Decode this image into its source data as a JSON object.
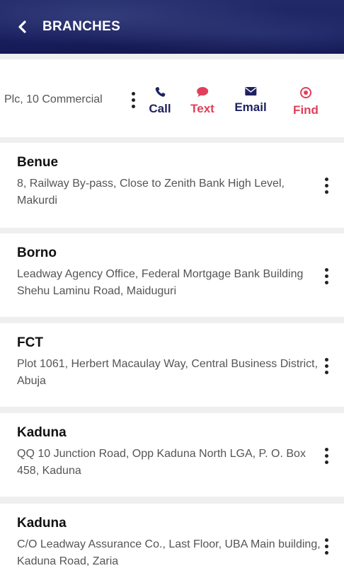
{
  "header": {
    "title": "BRANCHES",
    "back_icon": "chevron-left-icon"
  },
  "hq": {
    "address_fragment": "Plc, 10 Commercial",
    "actions": [
      {
        "label": "Call",
        "icon": "phone-icon",
        "color": "#1e2260"
      },
      {
        "label": "Text",
        "icon": "chat-bubble-icon",
        "color": "#e0405a"
      },
      {
        "label": "Email",
        "icon": "envelope-icon",
        "color": "#1e2260"
      },
      {
        "label": "Find",
        "icon": "target-icon",
        "color": "#e0405a"
      }
    ]
  },
  "branches": [
    {
      "name": "Benue",
      "address": "8, Railway By-pass, Close to Zenith Bank High Level, Makurdi"
    },
    {
      "name": "Borno",
      "address": "Leadway Agency Office, Federal Mortgage Bank Building Shehu Laminu Road, Maiduguri"
    },
    {
      "name": "FCT",
      "address": "Plot 1061, Herbert Macaulay Way, Central Business District, Abuja"
    },
    {
      "name": "Kaduna",
      "address": "QQ 10 Junction Road, Opp Kaduna North LGA, P. O. Box 458, Kaduna"
    },
    {
      "name": "Kaduna",
      "address": "C/O Leadway Assurance Co., Last Floor, UBA Main building, Kaduna Road, Zaria"
    }
  ]
}
